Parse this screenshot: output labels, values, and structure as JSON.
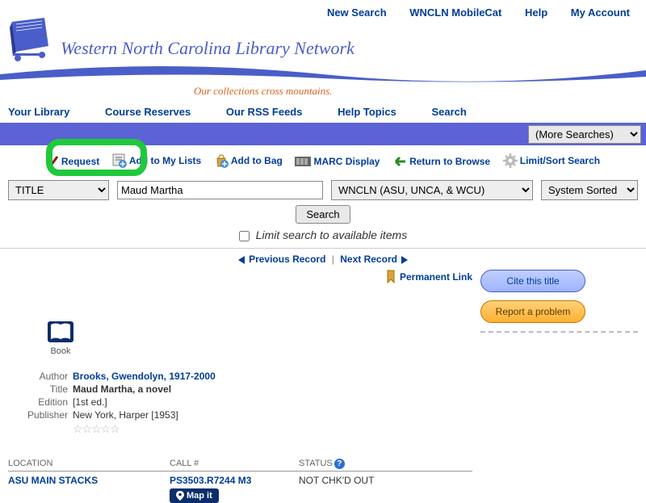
{
  "top_links": {
    "new_search": "New Search",
    "mobilecat": "WNCLN MobileCat",
    "help": "Help",
    "my_account": "My Account"
  },
  "header": {
    "title": "Western North Carolina Library Network",
    "tagline": "Our collections cross mountains."
  },
  "nav": {
    "your_library": "Your Library",
    "course_reserves": "Course Reserves",
    "rss": "Our RSS Feeds",
    "help_topics": "Help Topics",
    "search": "Search"
  },
  "more_searches": "(More Searches)",
  "actions": {
    "request": "Request",
    "add_lists": "Add to My Lists",
    "add_bag": "Add to Bag",
    "marc": "MARC Display",
    "return_browse": "Return to Browse",
    "limit_sort": "Limit/Sort Search"
  },
  "search_form": {
    "field_select": "TITLE",
    "query": "Maud Martha",
    "scope_select": "WNCLN (ASU, UNCA, & WCU)",
    "sort_select": "System Sorted",
    "search_btn": "Search",
    "limit_label": "Limit search to available items"
  },
  "rec_nav": {
    "prev": "Previous Record",
    "next": "Next Record"
  },
  "permalink": "Permanent Link",
  "side_buttons": {
    "cite": "Cite this title",
    "report": "Report a problem"
  },
  "item_type": "Book",
  "meta": {
    "author_k": "Author",
    "author_v": "Brooks, Gwendolyn, 1917-2000",
    "title_k": "Title",
    "title_v": "Maud Martha, a novel",
    "edition_k": "Edition",
    "edition_v": "[1st ed.]",
    "publisher_k": "Publisher",
    "publisher_v": "New York, Harper [1953]"
  },
  "holdings": {
    "head_location": "LOCATION",
    "head_call": "CALL #",
    "head_status": "STATUS",
    "location": "ASU MAIN STACKS",
    "call": "PS3503.R7244 M3",
    "status": "NOT CHK'D OUT",
    "mapit": "Map it"
  }
}
